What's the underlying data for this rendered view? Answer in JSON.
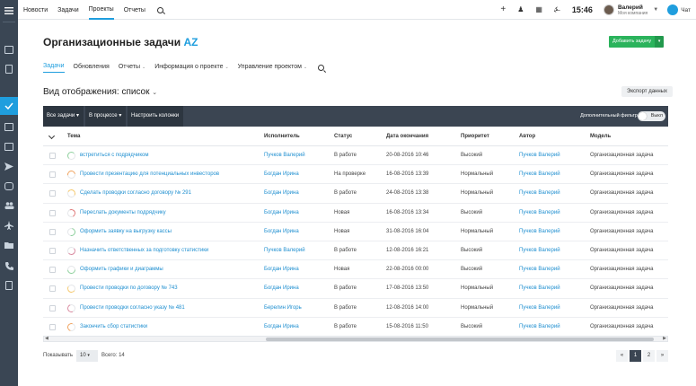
{
  "topnav": [
    "Новости",
    "Задачи",
    "Проекты",
    "Отчеты"
  ],
  "clock": "15:46",
  "user": {
    "name": "Валерий",
    "company": "Моя компания"
  },
  "chat_label": "Чат",
  "title_main": "Организационные задачи",
  "title_tag": "AZ",
  "add_task": "Добавить задачу",
  "subtabs": [
    "Задачи",
    "Обновления",
    "Отчеты",
    "Информация о проекте",
    "Управление проектом"
  ],
  "view_mode": "Вид отображения:",
  "view_value": "список",
  "export_label": "Экспорт данных",
  "toolbar": {
    "all_tasks": "Все задачи",
    "in_progress": "В процессе",
    "columns": "Настроить колонки",
    "extra_filter": "Дополнительный фильтр",
    "toggle": "Выкл"
  },
  "columns": [
    "Тема",
    "Исполнитель",
    "Статус",
    "Дата окончания",
    "Приоритет",
    "Автор",
    "Модель"
  ],
  "rows": [
    {
      "subject": "встретиться с подрядчиком",
      "assignee": "Пучков Валерий",
      "status": "В работе",
      "due": "20-08-2016 10:46",
      "priority": "Высокий",
      "author": "Пучков Валерий",
      "model": "Организационная задача",
      "ring_color": "#8fd19e"
    },
    {
      "subject": "Провести презентацию для потенциальных инвесторов",
      "assignee": "Богдан Ирина",
      "status": "На проверке",
      "due": "16-08-2016 13:39",
      "priority": "Нормальный",
      "author": "Пучков Валерий",
      "model": "Организационная задача",
      "ring_color": "#f0a35e"
    },
    {
      "subject": "Сделать проводки согласно договору № 291",
      "assignee": "Богдан Ирина",
      "status": "В работе",
      "due": "24-08-2016 13:38",
      "priority": "Нормальный",
      "author": "Пучков Валерий",
      "model": "Организационная задача",
      "ring_color": "#f5c86b"
    },
    {
      "subject": "Переслать документы подрядчику",
      "assignee": "Богдан Ирина",
      "status": "Новая",
      "due": "16-08-2016 13:34",
      "priority": "Высокий",
      "author": "Пучков Валерий",
      "model": "Организационная задача",
      "ring_color": "#e07b7b"
    },
    {
      "subject": "Оформить заявку на выгрузку кассы",
      "assignee": "Богдан Ирина",
      "status": "Новая",
      "due": "31-08-2016 16:04",
      "priority": "Нормальный",
      "author": "Пучков Валерий",
      "model": "Организационная задача",
      "ring_color": "#8fd19e"
    },
    {
      "subject": "Назначить ответственных за подготовку статистики",
      "assignee": "Пучков Валерий",
      "status": "В работе",
      "due": "12-08-2016 16:21",
      "priority": "Высокий",
      "author": "Пучков Валерий",
      "model": "Организационная задача",
      "ring_color": "#d98aa0"
    },
    {
      "subject": "Оформить графики и диаграммы",
      "assignee": "Богдан Ирина",
      "status": "Новая",
      "due": "22-08-2016 00:00",
      "priority": "Высокий",
      "author": "Пучков Валерий",
      "model": "Организационная задача",
      "ring_color": "#8fd19e"
    },
    {
      "subject": "Провести проводки по договору № 743",
      "assignee": "Богдан Ирина",
      "status": "В работе",
      "due": "17-08-2016 13:50",
      "priority": "Нормальный",
      "author": "Пучков Валерий",
      "model": "Организационная задача",
      "ring_color": "#f5c86b"
    },
    {
      "subject": "Провести проводки согласно указу № 481",
      "assignee": "Берелин Игорь",
      "status": "В работе",
      "due": "12-08-2016 14:00",
      "priority": "Нормальный",
      "author": "Пучков Валерий",
      "model": "Организационная задача",
      "ring_color": "#d98aa0"
    },
    {
      "subject": "Закончить сбор статистики",
      "assignee": "Богдан Ирина",
      "status": "В работе",
      "due": "15-08-2016 11:50",
      "priority": "Высокий",
      "author": "Пучков Валерий",
      "model": "Организационная задача",
      "ring_color": "#f0a35e"
    }
  ],
  "footer": {
    "show_label": "Показывать",
    "page_size": "10",
    "total": "Всего: 14"
  },
  "pages": [
    "1",
    "2"
  ],
  "colors": {
    "accent": "#1f9ede",
    "sidebar": "#3a4654",
    "add_button": "#2bb35c",
    "toolbar": "#3b4552"
  }
}
